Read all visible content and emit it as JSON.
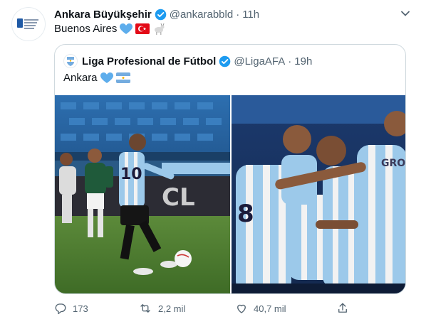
{
  "tweet": {
    "author_name": "Ankara Büyükşehir",
    "author_handle": "@ankarabbld",
    "time": "11h",
    "text": "Buenos Aires",
    "text_emojis": [
      "blue-heart",
      "turkey-flag",
      "goat"
    ]
  },
  "quoted": {
    "author_name": "Liga Profesional de Fútbol",
    "author_handle": "@LigaAFA",
    "time": "19h",
    "text": "Ankara",
    "text_emojis": [
      "blue-heart",
      "argentina-flag"
    ],
    "media": [
      {
        "kind": "photo",
        "subject": "penalty-kick-scene"
      },
      {
        "kind": "photo",
        "subject": "team-celebration",
        "shirt_text": "GRO"
      }
    ]
  },
  "actions": {
    "reply_count": "173",
    "retweet_count": "2,2 mil",
    "like_count": "40,7 mil"
  },
  "colors": {
    "accent": "#1d9bf0",
    "text": "#0f1419",
    "muted": "#536471",
    "border": "#cfd9de"
  }
}
